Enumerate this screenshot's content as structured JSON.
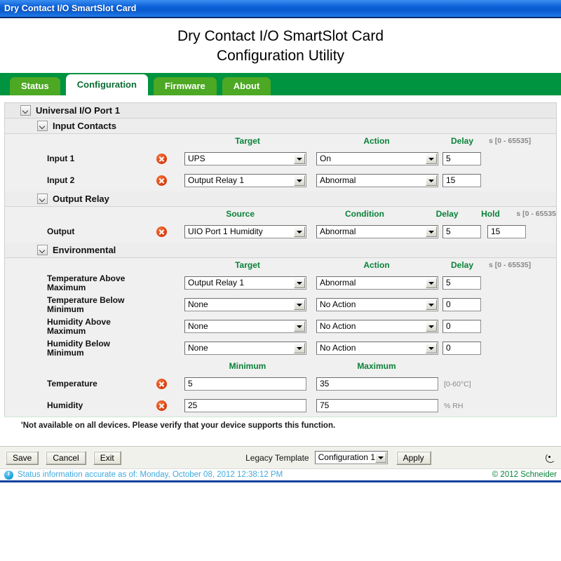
{
  "window": {
    "title": "Dry Contact I/O SmartSlot Card"
  },
  "header": {
    "line1": "Dry Contact I/O SmartSlot Card",
    "line2": "Configuration Utility"
  },
  "tabs": [
    {
      "label": "Status",
      "active": false
    },
    {
      "label": "Configuration",
      "active": true
    },
    {
      "label": "Firmware",
      "active": false
    },
    {
      "label": "About",
      "active": false
    }
  ],
  "port_section": {
    "title": "Universal I/O Port 1",
    "toggle_icon": "chevron-down-icon"
  },
  "input_contacts": {
    "title": "Input Contacts",
    "toggle_icon": "chevron-down-icon",
    "columns": {
      "target": "Target",
      "action": "Action",
      "delay": "Delay"
    },
    "range_note": "s [0 - 65535]",
    "rows": [
      {
        "label": "Input 1",
        "status_icon": "error-x-icon",
        "target": "UPS",
        "action": "On",
        "delay": "5"
      },
      {
        "label": "Input 2",
        "status_icon": "error-x-icon",
        "target": "Output Relay 1",
        "action": "Abnormal",
        "delay": "15"
      }
    ]
  },
  "output_relay": {
    "title": "Output Relay",
    "toggle_icon": "chevron-down-icon",
    "columns": {
      "source": "Source",
      "condition": "Condition",
      "delay": "Delay",
      "hold": "Hold"
    },
    "range_note": "s [0 - 65535",
    "rows": [
      {
        "label": "Output",
        "status_icon": "error-x-icon",
        "source": "UIO Port 1 Humidity",
        "condition": "Abnormal",
        "delay": "5",
        "hold": "15"
      }
    ]
  },
  "environmental": {
    "title": "Environmental",
    "toggle_icon": "chevron-down-icon",
    "columns": {
      "target": "Target",
      "action": "Action",
      "delay": "Delay"
    },
    "range_note": "s [0 - 65535]",
    "rows": [
      {
        "label": "Temperature Above Maximum",
        "target": "Output Relay 1",
        "action": "Abnormal",
        "delay": "5"
      },
      {
        "label": "Temperature Below Minimum",
        "target": "None",
        "action": "No Action",
        "delay": "0"
      },
      {
        "label": "Humidity Above Maximum",
        "target": "None",
        "action": "No Action",
        "delay": "0"
      },
      {
        "label": "Humidity Below Minimum",
        "target": "None",
        "action": "No Action",
        "delay": "0"
      }
    ],
    "limits_columns": {
      "minimum": "Minimum",
      "maximum": "Maximum"
    },
    "limits_rows": [
      {
        "label": "Temperature",
        "status_icon": "error-x-icon",
        "minimum": "5",
        "maximum": "35",
        "unit": "[0-60°C]"
      },
      {
        "label": "Humidity",
        "status_icon": "error-x-icon",
        "minimum": "25",
        "maximum": "75",
        "unit": "% RH"
      }
    ]
  },
  "footnote": "'Not available on all devices. Please verify that your device supports this function.",
  "actionbar": {
    "save": "Save",
    "cancel": "Cancel",
    "exit": "Exit",
    "legacy_label": "Legacy Template",
    "legacy_value": "Configuration 1",
    "apply": "Apply",
    "refresh_icon": "refresh-icon"
  },
  "statusbar": {
    "info_icon": "info-icon",
    "text": "Status information accurate as of: Monday, October 08, 2012 12:38:12 PM",
    "copyright": "© 2012 Schneider"
  },
  "colors": {
    "title_blue": "#0a5fd8",
    "brand_green": "#009340",
    "tab_green": "#4da824",
    "header_text_green": "#0a8139",
    "status_blue": "#3fa9dd",
    "error_orange": "#d93a0c"
  }
}
